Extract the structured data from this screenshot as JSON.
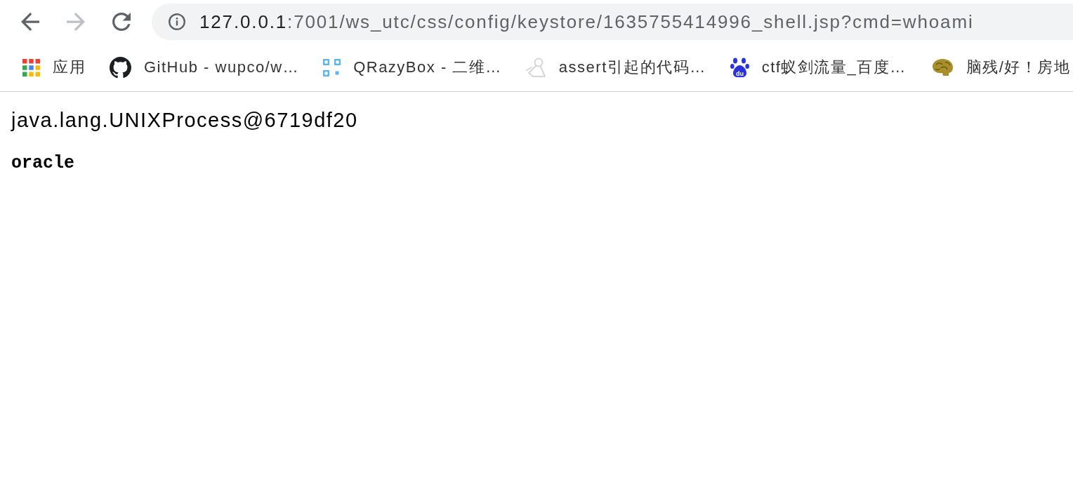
{
  "toolbar": {
    "nav": [
      {
        "kind": "back",
        "disabled": false
      },
      {
        "kind": "forward",
        "disabled": true
      },
      {
        "kind": "reload",
        "disabled": false
      }
    ],
    "address": {
      "host": "127.0.0.1",
      "path": ":7001/ws_utc/css/config/keystore/1635755414996_shell.jsp?cmd=whoami"
    }
  },
  "bookmarks": [
    {
      "kind": "apps",
      "label": "应用"
    },
    {
      "kind": "github",
      "label": "GitHub - wupco/w…"
    },
    {
      "kind": "squares",
      "label": "QRazyBox - 二维…"
    },
    {
      "kind": "figure",
      "label": "assert引起的代码…"
    },
    {
      "kind": "paw",
      "badge": "du",
      "label": "ctf蚁剑流量_百度…"
    },
    {
      "kind": "brain",
      "label": "脑残/好！房地"
    }
  ],
  "page": {
    "lines": [
      {
        "kind": "text",
        "text": "java.lang.UNIXProcess@6719df20"
      },
      {
        "kind": "pre",
        "text": "oracle"
      }
    ]
  }
}
